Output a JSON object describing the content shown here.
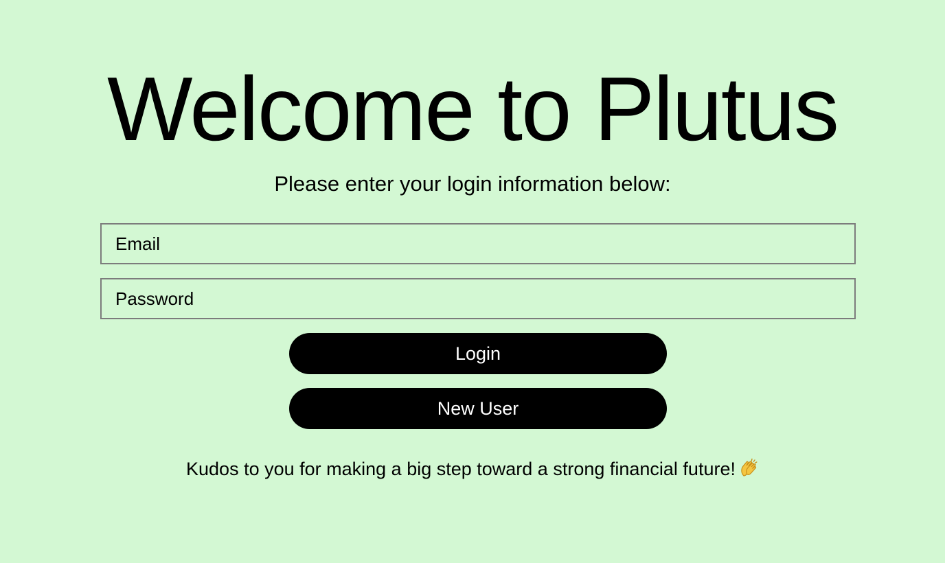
{
  "header": {
    "title": "Welcome to Plutus",
    "subtitle": "Please enter your login information below:"
  },
  "form": {
    "email_placeholder": "Email",
    "password_placeholder": "Password",
    "login_label": "Login",
    "new_user_label": "New User"
  },
  "footer": {
    "message": "Kudos to you for making a big step toward a strong financial future!",
    "icon": "clapping-hands-icon"
  },
  "colors": {
    "background": "#d3f8d3",
    "button": "#000000",
    "button_text": "#ffffff",
    "field_border": "#7c7c7c"
  }
}
